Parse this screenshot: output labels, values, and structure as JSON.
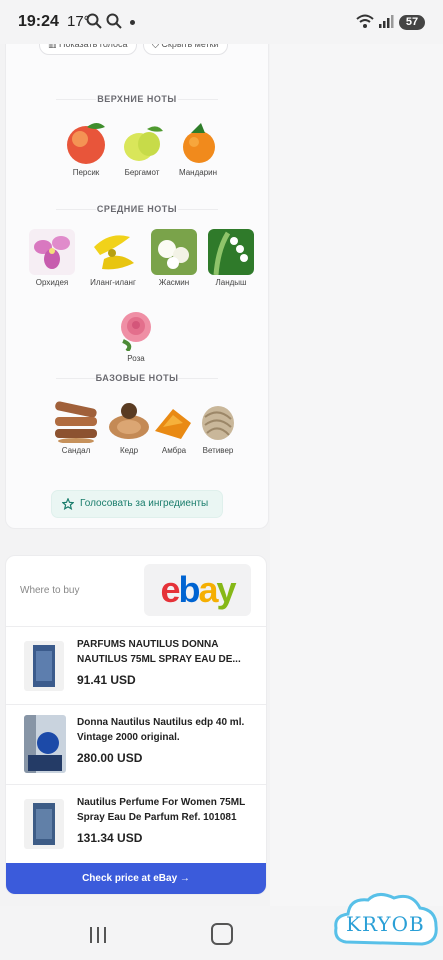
{
  "status_bar": {
    "time": "19:24",
    "temperature": "17°",
    "battery": "57",
    "icons": [
      "search-icon",
      "search-icon",
      "dot-icon",
      "wifi-icon",
      "signal-icon"
    ]
  },
  "top_actions": {
    "show_votes": "Показать голоса",
    "hide_tags": "Скрыть метки"
  },
  "notes": {
    "top": {
      "title": "ВЕРХНИЕ НОТЫ",
      "items": [
        "Персик",
        "Бергамот",
        "Мандарин"
      ]
    },
    "middle": {
      "title": "СРЕДНИЕ НОТЫ",
      "items": [
        "Орхидея",
        "Иланг-иланг",
        "Жасмин",
        "Ландыш",
        "Роза"
      ]
    },
    "base": {
      "title": "БАЗОВЫЕ НОТЫ",
      "items": [
        "Сандал",
        "Кедр",
        "Амбра",
        "Ветивер"
      ]
    }
  },
  "vote_button": "Голосовать за ингредиенты",
  "shop": {
    "where_to_buy": "Where to buy",
    "listings": [
      {
        "title": "PARFUMS NAUTILUS DONNA NAUTILUS 75ML SPRAY EAU DE...",
        "price": "91.41 USD"
      },
      {
        "title": "Donna Nautilus Nautilus edp 40 ml. Vintage 2000 original.",
        "price": "280.00 USD"
      },
      {
        "title": "Nautilus Perfume For Women 75ML Spray Eau De Parfum Ref. 101081",
        "price": "131.34 USD"
      }
    ],
    "check_button": "Check price at eBay →"
  },
  "watermark": "KRYOB",
  "colors": {
    "accent": "#3b5bdb",
    "vote_text": "#1a7d6c",
    "vote_bg": "#eaf6f3"
  }
}
